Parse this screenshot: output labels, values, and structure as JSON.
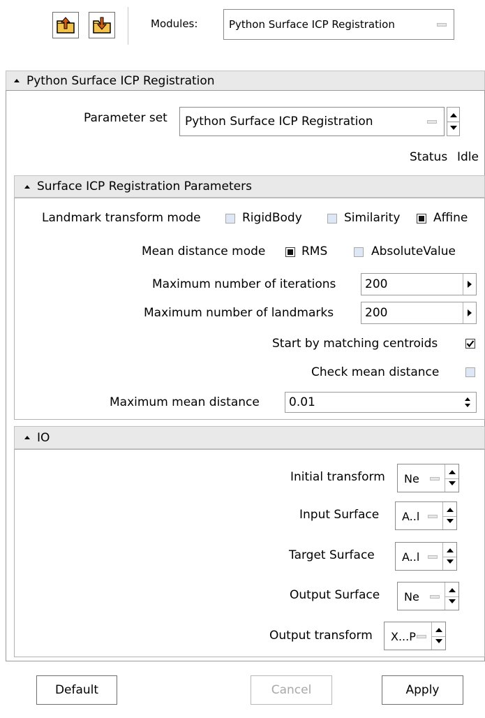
{
  "toolbar": {
    "load_icon": "folder-up-icon",
    "save_icon": "folder-down-icon",
    "modules_label": "Modules:",
    "modules_value": "Python Surface ICP Registration"
  },
  "module_panel": {
    "title": "Python Surface ICP Registration",
    "parameter_set_label": "Parameter set",
    "parameter_set_value": "Python Surface ICP Registration",
    "status_label": "Status",
    "status_value": "Idle"
  },
  "params": {
    "title": "Surface ICP Registration Parameters",
    "landmark_label": "Landmark transform mode",
    "landmark_options": [
      {
        "label": "RigidBody",
        "checked": false
      },
      {
        "label": "Similarity",
        "checked": false
      },
      {
        "label": "Affine",
        "checked": true
      }
    ],
    "mean_mode_label": "Mean distance mode",
    "mean_mode_options": [
      {
        "label": "RMS",
        "checked": true
      },
      {
        "label": "AbsoluteValue",
        "checked": false
      }
    ],
    "max_iter_label": "Maximum number of iterations",
    "max_iter_value": "200",
    "max_landmarks_label": "Maximum number of landmarks",
    "max_landmarks_value": "200",
    "centroids_label": "Start by matching centroids",
    "centroids_checked": true,
    "check_mean_label": "Check mean distance",
    "check_mean_checked": false,
    "max_mean_label": "Maximum mean distance",
    "max_mean_value": "0.01"
  },
  "io": {
    "title": "IO",
    "rows": [
      {
        "label": "Initial transform",
        "value": "Ne"
      },
      {
        "label": "Input Surface",
        "value": "A..l"
      },
      {
        "label": "Target Surface",
        "value": "A..l"
      },
      {
        "label": "Output Surface",
        "value": "Ne"
      },
      {
        "label": "Output transform",
        "value": "X...P"
      }
    ]
  },
  "buttons": {
    "default": "Default",
    "cancel": "Cancel",
    "apply": "Apply"
  },
  "colors": {
    "folder_fill": "#f3c24a",
    "folder_arrow": "#d35b12",
    "header_bg": "#e9e9e9",
    "unchecked_fill": "#dde7f5"
  }
}
